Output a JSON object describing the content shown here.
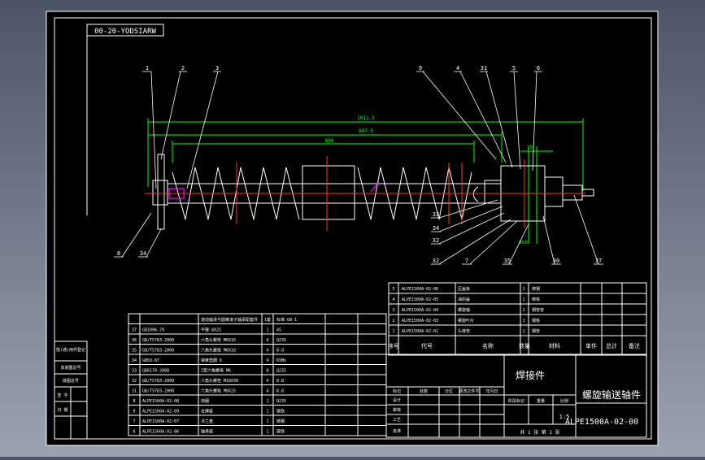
{
  "drawing": {
    "code_stamp": "00-20-YODSIARW",
    "dims": {
      "overall": "1011.5",
      "mid": "887.5",
      "flight": "800",
      "hub_dia": "Φ50",
      "hub_width": "15"
    },
    "balloons_top": [
      "1",
      "2",
      "3",
      "9",
      "4",
      "31",
      "5",
      "6"
    ],
    "balloons_bottom": [
      "8",
      "34",
      "33",
      "34",
      "32",
      "32",
      "7",
      "35",
      "30",
      "37"
    ]
  },
  "parts_upper": {
    "rows": [
      {
        "no": "5",
        "code": "ALPE1500A-02-06",
        "name": "压盖板",
        "qty": "1",
        "material": "铸钢"
      },
      {
        "no": "4",
        "code": "ALPE1500A-02-05",
        "name": "油封盖",
        "qty": "1",
        "material": "铸铁"
      },
      {
        "no": "3",
        "code": "ALPE1500A-02-04",
        "name": "螺旋轴",
        "qty": "1",
        "material": "钢管管"
      },
      {
        "no": "2",
        "code": "ALPE1500A-02-03",
        "name": "螺旋叶片",
        "qty": "1",
        "material": "钢板"
      },
      {
        "no": "1",
        "code": "ALPE1500A-02-01",
        "name": "头接管",
        "qty": "1",
        "material": "钢管"
      }
    ],
    "header": {
      "no": "序号",
      "code": "代号",
      "name": "名称",
      "qty": "数量",
      "material": "材料",
      "unit_weight": "单件",
      "total_weight": "总计",
      "weight": "重量",
      "remark": "备注"
    }
  },
  "parts_lower": {
    "rows": [
      {
        "no": "",
        "code": "",
        "name": "滚动轴承与圆锥滚子轴承配套件",
        "qty": "1套",
        "remark": "标准 GB-1"
      },
      {
        "no": "37",
        "code": "GB1096-79",
        "name": "平键 8X25",
        "qty": "1",
        "remark": "45"
      },
      {
        "no": "36",
        "code": "GB/T5783-2000",
        "name": "六角头螺栓 M6X16",
        "qty": "4",
        "remark": "Q235"
      },
      {
        "no": "35",
        "code": "GB/T5783-2000",
        "name": "六角头螺栓 M6X16",
        "qty": "4",
        "remark": "8.8"
      },
      {
        "no": "34",
        "code": "GB93-87",
        "name": "弹簧垫圈 6",
        "qty": "4",
        "remark": "65Mn"
      },
      {
        "no": "33",
        "code": "GB6170-2000",
        "name": "I型六角螺母 M6",
        "qty": "8",
        "remark": "Q235"
      },
      {
        "no": "32",
        "code": "GB/T5783-2000",
        "name": "六角头螺栓 M10X30",
        "qty": "4",
        "remark": "8.8"
      },
      {
        "no": "31",
        "code": "GB/T5783-2000",
        "name": "六角头螺栓 M8X25",
        "qty": "4",
        "remark": "8.8"
      },
      {
        "no": "8",
        "code": "ALPE1500A-02-08",
        "name": "挡圈",
        "qty": "1",
        "remark": "Q235"
      },
      {
        "no": "9",
        "code": "ALPE1500A-02-09",
        "name": "支撑座",
        "qty": "1",
        "remark": "铸铁"
      },
      {
        "no": "7",
        "code": "ALPE1500A-02-07",
        "name": "法兰盘",
        "qty": "1",
        "remark": "铸钢"
      },
      {
        "no": "6",
        "code": "ALPE1500A-02-06",
        "name": "轴承座",
        "qty": "1",
        "remark": "铸铁"
      }
    ]
  },
  "title_block": {
    "part_title": "焊接件",
    "drawing_title": "螺旋输送轴件",
    "drawing_no": "ALPE1500A-02-00",
    "scale": "1:5",
    "sheet": "共 1 张 第 1 张",
    "labels": [
      "标记",
      "处数",
      "分区",
      "更改文件号",
      "签名",
      "年月日"
    ],
    "roles": [
      "设计",
      "审核",
      "工艺",
      "批准"
    ],
    "stage_labels": [
      "阶段标记",
      "重量",
      "比例"
    ]
  },
  "side_strip": {
    "cells": [
      "借(通)用件登记",
      "旧底图总号",
      "底图总号",
      "签 字",
      "日 期"
    ]
  },
  "colors": {
    "background": "#000000",
    "line": "#ffffff",
    "dimension": "#00ff00",
    "centerline": "#ff3333",
    "hidden": "#ff00ff",
    "leader": "#ffffff"
  }
}
